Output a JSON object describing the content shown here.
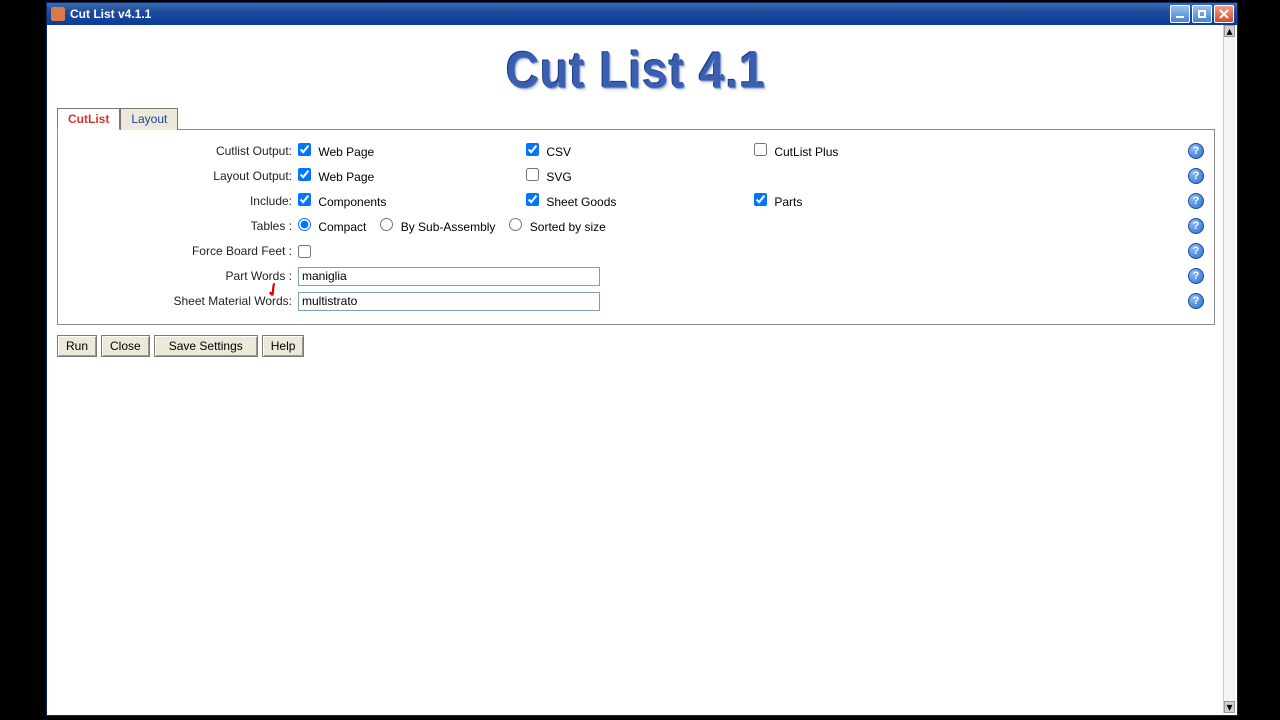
{
  "window": {
    "title": "Cut List v4.1.1"
  },
  "logo": "Cut List 4.1",
  "tabs": {
    "cutlist": "CutList",
    "layout": "Layout"
  },
  "rows": {
    "cutlist_output": {
      "label": "Cutlist Output:",
      "webpage": "Web Page",
      "csv": "CSV",
      "cutlistplus": "CutList Plus"
    },
    "layout_output": {
      "label": "Layout Output:",
      "webpage": "Web Page",
      "svg": "SVG"
    },
    "include": {
      "label": "Include:",
      "components": "Components",
      "sheetgoods": "Sheet Goods",
      "parts": "Parts"
    },
    "tables": {
      "label": "Tables :",
      "compact": "Compact",
      "bysub": "By Sub-Assembly",
      "sorted": "Sorted by size"
    },
    "force_bf": {
      "label": "Force Board Feet :"
    },
    "part_words": {
      "label": "Part Words :",
      "value": "maniglia"
    },
    "sheet_words": {
      "label": "Sheet Material Words:",
      "value": "multistrato"
    }
  },
  "buttons": {
    "run": "Run",
    "close": "Close",
    "save": "Save Settings",
    "help": "Help"
  }
}
